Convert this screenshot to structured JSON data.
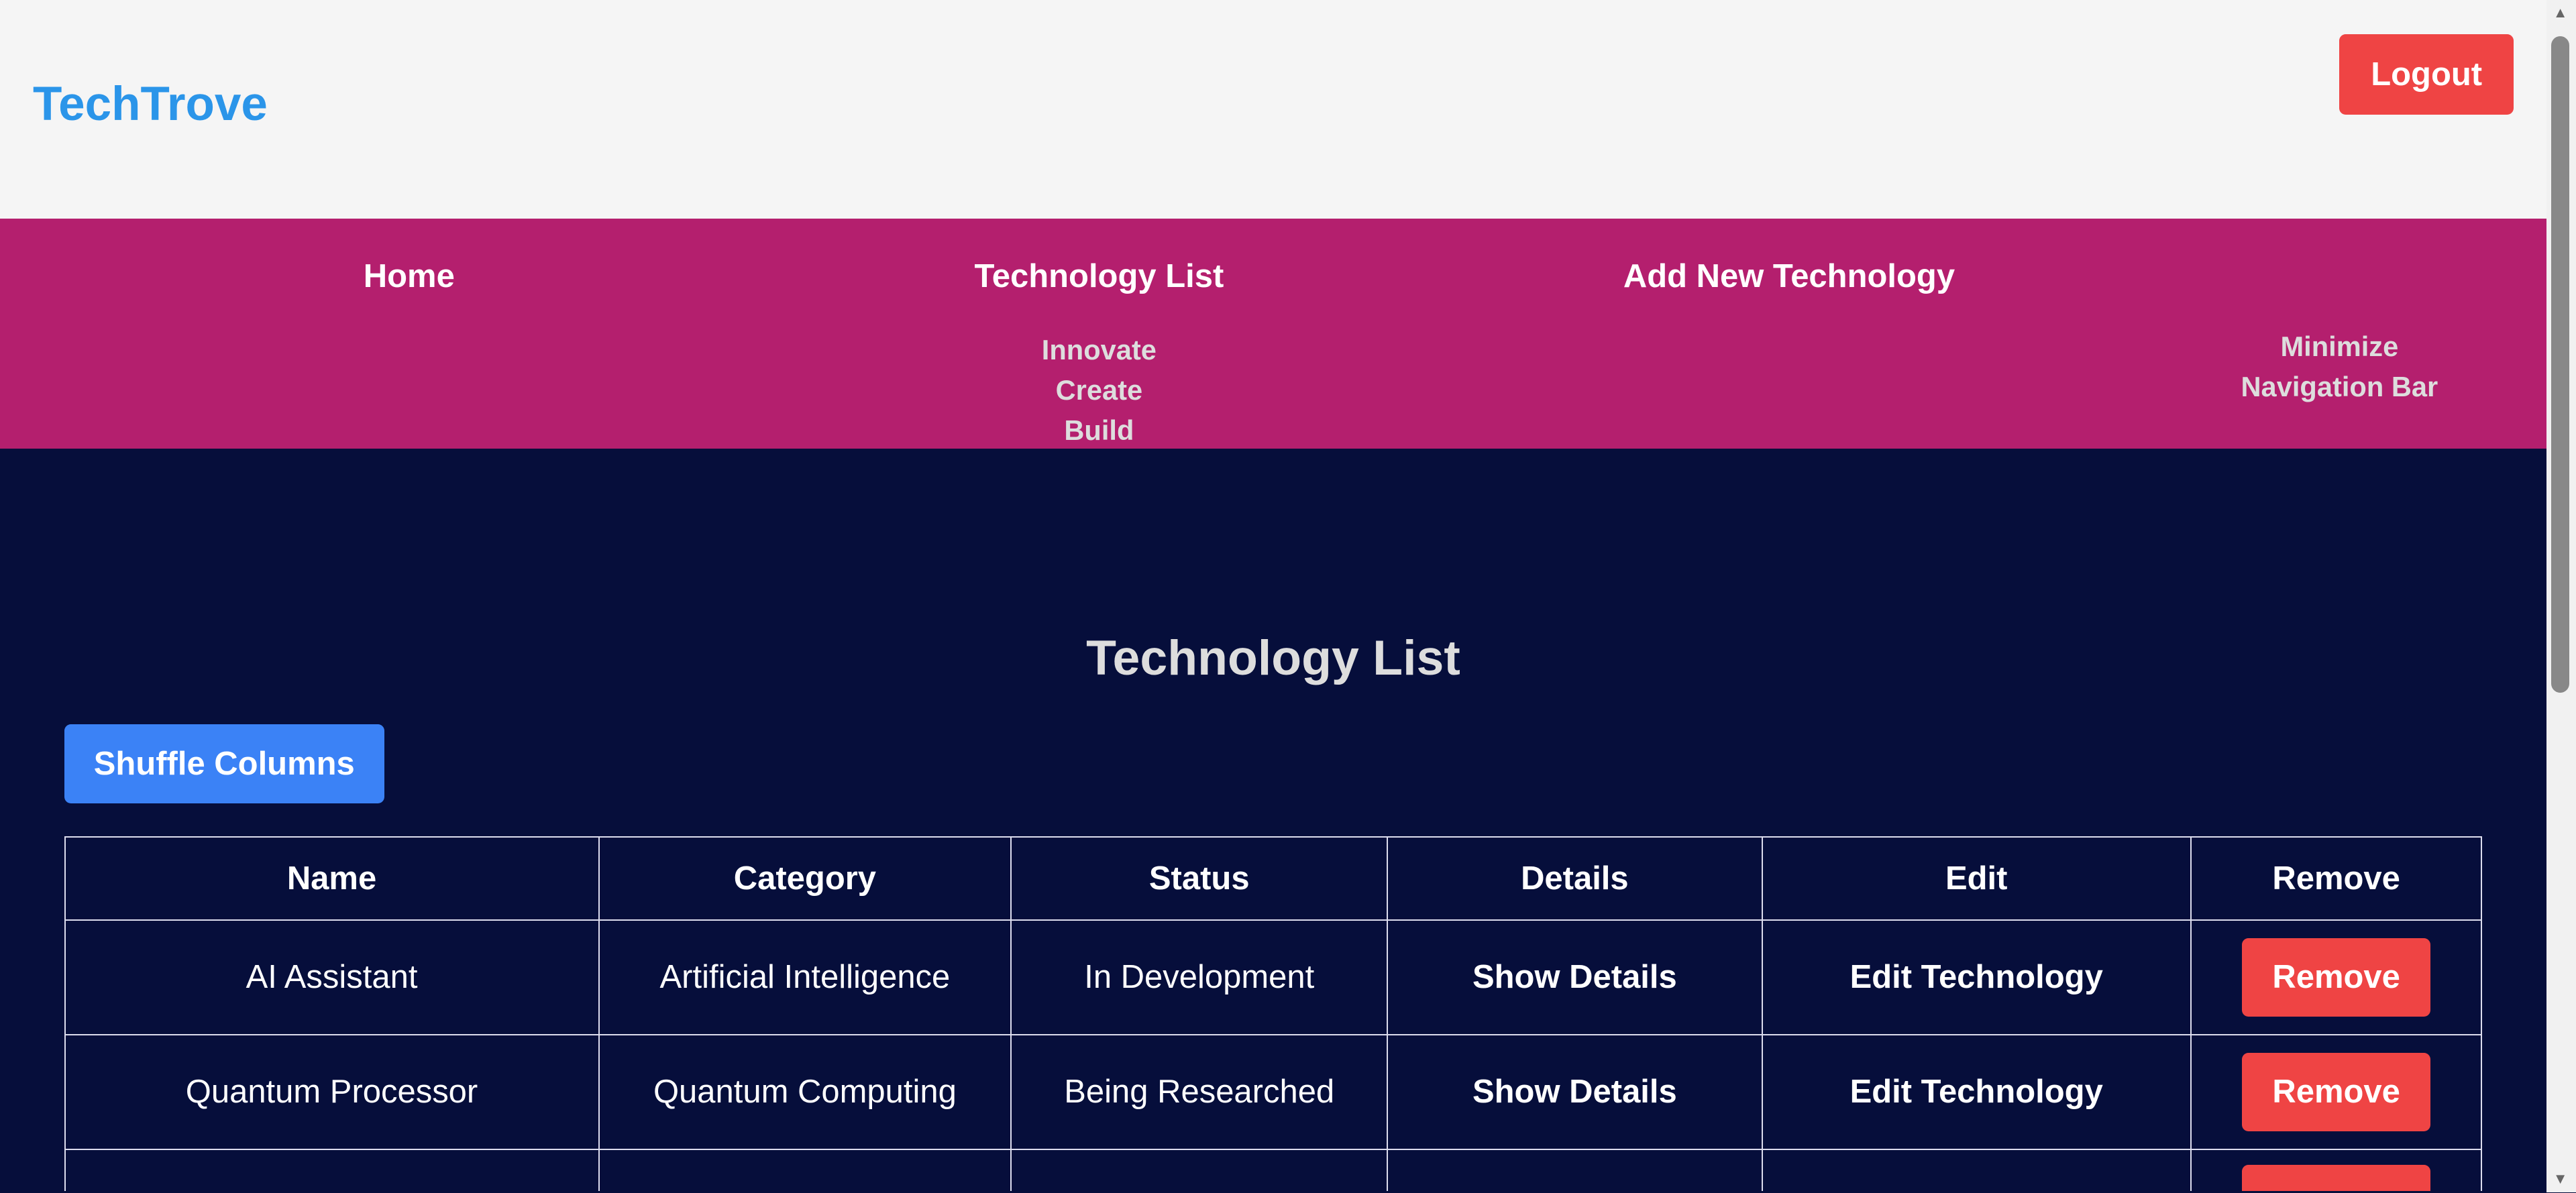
{
  "header": {
    "logo": "TechTrove",
    "logout": "Logout"
  },
  "nav": {
    "items": [
      "Home",
      "Technology List",
      "Add New Technology"
    ],
    "tagline": [
      "Innovate",
      "Create",
      "Build"
    ],
    "minimize": [
      "Minimize",
      "Navigation Bar"
    ]
  },
  "main": {
    "title": "Technology List",
    "shuffle": "Shuffle Columns",
    "columns": [
      "Name",
      "Category",
      "Status",
      "Details",
      "Edit",
      "Remove"
    ],
    "rows": [
      {
        "name": "AI Assistant",
        "category": "Artificial Intelligence",
        "status": "In Development",
        "details": "Show Details",
        "edit": "Edit Technology",
        "remove": "Remove"
      },
      {
        "name": "Quantum Processor",
        "category": "Quantum Computing",
        "status": "Being Researched",
        "details": "Show Details",
        "edit": "Edit Technology",
        "remove": "Remove"
      }
    ]
  },
  "colors": {
    "accent": "#2b95e9",
    "nav": "#b41f6e",
    "bg": "#060e3b",
    "danger": "#ef4444",
    "primary": "#3b82f6"
  }
}
